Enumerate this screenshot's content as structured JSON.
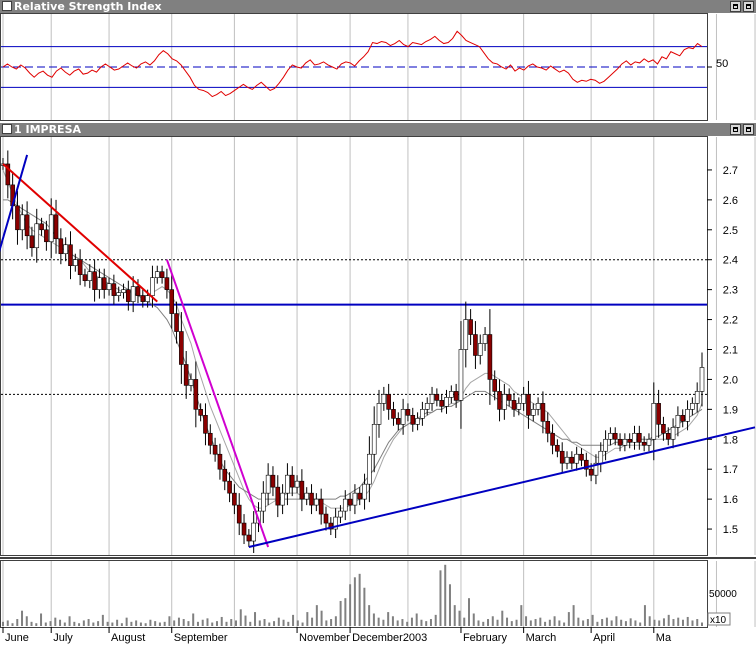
{
  "panels": {
    "rsi": {
      "title": "Relative Strength Index",
      "level_label": "50"
    },
    "price": {
      "title": "1 IMPRESA"
    },
    "volume": {
      "tick_label": "50000",
      "multiplier_label": "x10"
    }
  },
  "colors": {
    "rsi_line": "#e00000",
    "ref_line": "#0000c0",
    "trendline": "#0000c0",
    "down_trend_red": "#e00000",
    "down_trend_magenta": "#d000d0",
    "candle_up": "#ffffff",
    "candle_down": "#8b0000",
    "moving_average": "#808080",
    "volume_bar": "#808080"
  },
  "chart_data": [
    {
      "type": "line",
      "panel": "rsi",
      "title": "Relative Strength Index",
      "ylim": [
        0,
        100
      ],
      "reference_lines": [
        70,
        50,
        30
      ],
      "yticks": [
        "50"
      ],
      "series": [
        {
          "values": [
            50,
            53,
            50,
            48,
            52,
            49,
            44,
            40,
            44,
            46,
            42,
            40,
            46,
            49,
            45,
            42,
            46,
            48,
            43,
            44,
            47,
            45,
            50,
            53,
            50,
            47,
            48,
            51,
            54,
            51,
            49,
            53,
            55,
            52,
            56,
            62,
            66,
            63,
            58,
            56,
            52,
            46,
            40,
            32,
            28,
            27,
            25,
            21,
            23,
            26,
            22,
            24,
            27,
            30,
            33,
            30,
            28,
            32,
            35,
            31,
            27,
            29,
            34,
            40,
            47,
            52,
            50,
            49,
            54,
            57,
            52,
            53,
            55,
            52,
            50,
            48,
            53,
            55,
            54,
            51,
            56,
            60,
            65,
            74,
            73,
            75,
            74,
            71,
            73,
            76,
            72,
            70,
            74,
            73,
            72,
            75,
            77,
            80,
            76,
            73,
            74,
            78,
            85,
            81,
            76,
            74,
            72,
            70,
            64,
            58,
            54,
            53,
            50,
            48,
            52,
            46,
            49,
            47,
            51,
            53,
            50,
            49,
            47,
            51,
            48,
            45,
            47,
            44,
            38,
            35,
            37,
            36,
            38,
            37,
            34,
            36,
            40,
            44,
            48,
            53,
            56,
            52,
            55,
            54,
            58,
            55,
            57,
            53,
            60,
            58,
            65,
            63,
            61,
            67,
            69,
            68,
            73,
            70
          ]
        }
      ]
    },
    {
      "type": "candlestick",
      "panel": "price",
      "title": "1 IMPRESA",
      "ylim": [
        1.42,
        2.8
      ],
      "yticks": [
        1.5,
        1.6,
        1.7,
        1.8,
        1.9,
        2.0,
        2.1,
        2.2,
        2.3,
        2.4,
        2.5,
        2.6,
        2.7
      ],
      "xticks": [
        "June",
        "July",
        "August",
        "September",
        "November",
        "December2003",
        "February",
        "March",
        "April",
        "Ma"
      ],
      "horizontal_lines": [
        {
          "y": 2.4,
          "style": "dotted"
        },
        {
          "y": 2.25,
          "style": "solid"
        },
        {
          "y": 1.95,
          "style": "dotted"
        }
      ],
      "close": [
        2.72,
        2.65,
        2.58,
        2.5,
        2.55,
        2.48,
        2.44,
        2.52,
        2.5,
        2.46,
        2.55,
        2.47,
        2.42,
        2.45,
        2.38,
        2.4,
        2.35,
        2.33,
        2.36,
        2.3,
        2.34,
        2.3,
        2.32,
        2.28,
        2.29,
        2.3,
        2.26,
        2.31,
        2.28,
        2.26,
        2.28,
        2.34,
        2.36,
        2.34,
        2.3,
        2.22,
        2.16,
        2.05,
        1.98,
        2.0,
        1.9,
        1.88,
        1.82,
        1.78,
        1.75,
        1.7,
        1.66,
        1.62,
        1.58,
        1.52,
        1.48,
        1.46,
        1.52,
        1.56,
        1.62,
        1.68,
        1.64,
        1.58,
        1.62,
        1.68,
        1.64,
        1.66,
        1.6,
        1.62,
        1.58,
        1.6,
        1.55,
        1.52,
        1.5,
        1.54,
        1.56,
        1.6,
        1.58,
        1.62,
        1.6,
        1.65,
        1.75,
        1.85,
        1.92,
        1.95,
        1.9,
        1.87,
        1.85,
        1.9,
        1.88,
        1.85,
        1.87,
        1.9,
        1.92,
        1.95,
        1.93,
        1.91,
        1.94,
        1.96,
        1.93,
        2.1,
        2.2,
        2.15,
        2.08,
        2.12,
        2.15,
        2.0,
        1.96,
        1.9,
        1.95,
        1.93,
        1.9,
        1.92,
        1.95,
        1.88,
        1.9,
        1.92,
        1.86,
        1.82,
        1.78,
        1.76,
        1.72,
        1.74,
        1.72,
        1.75,
        1.73,
        1.7,
        1.68,
        1.72,
        1.76,
        1.8,
        1.82,
        1.8,
        1.78,
        1.8,
        1.79,
        1.82,
        1.79,
        1.78,
        1.8,
        1.92,
        1.85,
        1.82,
        1.8,
        1.84,
        1.88,
        1.86,
        1.9,
        1.92,
        1.96,
        2.04
      ],
      "moving_averages": [
        {
          "values": [
            2.7,
            2.66,
            2.62,
            2.58,
            2.55,
            2.52,
            2.5,
            2.49,
            2.48,
            2.47,
            2.46,
            2.45,
            2.44,
            2.43,
            2.42,
            2.41,
            2.4,
            2.38,
            2.36,
            2.35,
            2.34,
            2.33,
            2.32,
            2.31,
            2.3,
            2.29,
            2.29,
            2.29,
            2.28,
            2.28,
            2.28,
            2.29,
            2.3,
            2.31,
            2.3,
            2.28,
            2.25,
            2.2,
            2.16,
            2.12,
            2.06,
            2.01,
            1.96,
            1.91,
            1.87,
            1.83,
            1.79,
            1.75,
            1.71,
            1.67,
            1.63,
            1.6,
            1.58,
            1.57,
            1.57,
            1.58,
            1.59,
            1.6,
            1.61,
            1.62,
            1.62,
            1.62,
            1.61,
            1.61,
            1.6,
            1.6,
            1.59,
            1.58,
            1.57,
            1.57,
            1.57,
            1.57,
            1.58,
            1.59,
            1.6,
            1.61,
            1.63,
            1.66,
            1.7,
            1.74,
            1.77,
            1.8,
            1.82,
            1.84,
            1.85,
            1.86,
            1.86,
            1.87,
            1.88,
            1.89,
            1.9,
            1.9,
            1.91,
            1.92,
            1.92,
            1.94,
            1.97,
            1.99,
            2.0,
            2.01,
            2.02,
            2.02,
            2.01,
            2.0,
            1.99,
            1.98,
            1.96,
            1.95,
            1.94,
            1.93,
            1.92,
            1.91,
            1.9,
            1.89,
            1.87,
            1.85,
            1.83,
            1.81,
            1.79,
            1.78,
            1.77,
            1.76,
            1.75,
            1.74,
            1.74,
            1.75,
            1.76,
            1.77,
            1.77,
            1.78,
            1.78,
            1.78,
            1.78,
            1.78,
            1.79,
            1.8,
            1.8,
            1.8,
            1.8,
            1.81,
            1.82,
            1.83,
            1.84,
            1.86,
            1.88,
            1.92
          ]
        },
        {
          "values": [
            2.6,
            2.6,
            2.59,
            2.58,
            2.57,
            2.56,
            2.55,
            2.54,
            2.53,
            2.52,
            2.5,
            2.48,
            2.46,
            2.44,
            2.42,
            2.41,
            2.4,
            2.39,
            2.38,
            2.37,
            2.36,
            2.35,
            2.34,
            2.33,
            2.32,
            2.31,
            2.3,
            2.29,
            2.28,
            2.27,
            2.26,
            2.25,
            2.24,
            2.22,
            2.2,
            2.17,
            2.13,
            2.09,
            2.05,
            2.0,
            1.95,
            1.9,
            1.85,
            1.81,
            1.77,
            1.73,
            1.7,
            1.68,
            1.66,
            1.64,
            1.63,
            1.62,
            1.61,
            1.6,
            1.6,
            1.6,
            1.6,
            1.6,
            1.6,
            1.6,
            1.6,
            1.6,
            1.6,
            1.6,
            1.6,
            1.6,
            1.6,
            1.6,
            1.6,
            1.6,
            1.61,
            1.61,
            1.62,
            1.63,
            1.64,
            1.66,
            1.68,
            1.7,
            1.73,
            1.76,
            1.79,
            1.81,
            1.83,
            1.84,
            1.85,
            1.86,
            1.87,
            1.88,
            1.89,
            1.89,
            1.9,
            1.9,
            1.91,
            1.91,
            1.92,
            1.93,
            1.94,
            1.95,
            1.96,
            1.96,
            1.96,
            1.95,
            1.94,
            1.93,
            1.92,
            1.91,
            1.9,
            1.89,
            1.88,
            1.87,
            1.86,
            1.85,
            1.84,
            1.83,
            1.82,
            1.81,
            1.8,
            1.8,
            1.79,
            1.79,
            1.78,
            1.78,
            1.78,
            1.78,
            1.78,
            1.78,
            1.78,
            1.79,
            1.79,
            1.79,
            1.79,
            1.8,
            1.8,
            1.8,
            1.8,
            1.81,
            1.81,
            1.82,
            1.83,
            1.84,
            1.85,
            1.86,
            1.87,
            1.88,
            1.89,
            1.9
          ]
        }
      ],
      "trendlines": [
        {
          "color": "red",
          "points": [
            [
              0,
              2.72
            ],
            [
              32,
              2.26
            ]
          ]
        },
        {
          "color": "magenta",
          "points": [
            [
              34,
              2.4
            ],
            [
              55,
              1.44
            ]
          ]
        },
        {
          "color": "blue",
          "points": [
            [
              51,
              1.44
            ],
            [
              156,
              1.84
            ]
          ]
        },
        {
          "color": "blue",
          "points": [
            [
              -2,
              2.36
            ],
            [
              5,
              2.75
            ]
          ]
        }
      ]
    },
    {
      "type": "bar",
      "panel": "volume",
      "unit": "x10",
      "yticks": [
        50000
      ],
      "values": [
        6,
        8,
        4,
        10,
        22,
        14,
        6,
        4,
        18,
        5,
        7,
        12,
        9,
        5,
        14,
        6,
        4,
        8,
        10,
        5,
        7,
        16,
        6,
        5,
        9,
        4,
        12,
        6,
        8,
        5,
        4,
        9,
        7,
        5,
        6,
        14,
        8,
        12,
        10,
        7,
        18,
        6,
        9,
        11,
        5,
        7,
        13,
        6,
        10,
        8,
        24,
        15,
        6,
        20,
        8,
        10,
        5,
        7,
        12,
        9,
        6,
        16,
        8,
        5,
        20,
        12,
        30,
        22,
        8,
        10,
        14,
        36,
        40,
        60,
        70,
        75,
        55,
        30,
        18,
        12,
        9,
        20,
        14,
        8,
        10,
        6,
        12,
        18,
        9,
        7,
        10,
        16,
        80,
        88,
        60,
        30,
        22,
        12,
        40,
        18,
        8,
        6,
        10,
        14,
        9,
        22,
        12,
        7,
        9,
        30,
        14,
        8,
        10,
        12,
        6,
        9,
        14,
        8,
        5,
        20,
        30,
        12,
        8,
        10,
        16,
        6,
        10,
        12,
        8,
        14,
        9,
        7,
        11,
        8,
        5,
        30,
        14,
        9,
        8,
        11,
        16,
        10,
        12,
        9,
        13,
        8,
        10,
        5
      ]
    }
  ]
}
